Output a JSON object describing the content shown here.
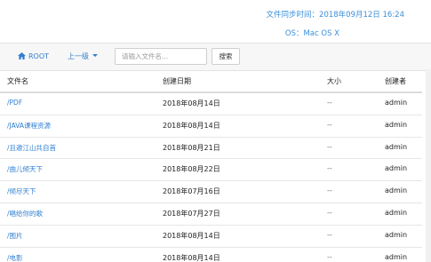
{
  "header": {
    "sync_time": "文件同步时间：2018年09月12日 16:24",
    "os": "OS：Mac OS X"
  },
  "toolbar": {
    "root_label": "ROOT",
    "up_label": "上一级",
    "search_placeholder": "请输入文件名...",
    "search_button": "搜索"
  },
  "table": {
    "columns": [
      "文件名",
      "创建日期",
      "大小",
      "创建者"
    ],
    "rows": [
      {
        "name": "/PDF",
        "date": "2018年08月14日",
        "size": "--",
        "creator": "admin"
      },
      {
        "name": "/JAVA课程资源",
        "date": "2018年08月14日",
        "size": "--",
        "creator": "admin"
      },
      {
        "name": "/且邀江山共自首",
        "date": "2018年08月21日",
        "size": "--",
        "creator": "admin"
      },
      {
        "name": "/曲儿倾天下",
        "date": "2018年08月22日",
        "size": "--",
        "creator": "admin"
      },
      {
        "name": "/倾尽天下",
        "date": "2018年07月16日",
        "size": "--",
        "creator": "admin"
      },
      {
        "name": "/唱给你的歌",
        "date": "2018年07月27日",
        "size": "--",
        "creator": "admin"
      },
      {
        "name": "/图片",
        "date": "2018年08月14日",
        "size": "--",
        "creator": "admin"
      },
      {
        "name": "/电影",
        "date": "2018年08月14日",
        "size": "--",
        "creator": "admin"
      }
    ]
  },
  "colors": {
    "link": "#2f7fd0",
    "info": "#3a8fd9",
    "toolbar_bg": "#f7f7f7"
  },
  "icons": {
    "root": "home-icon",
    "up": "caret-down-icon"
  }
}
